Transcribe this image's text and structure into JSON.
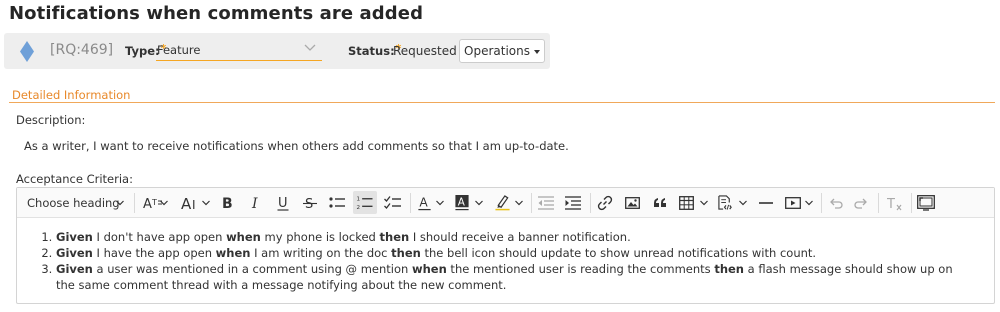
{
  "page": {
    "title": "Notifications when comments are added"
  },
  "header": {
    "req_id": "[RQ:469]",
    "type_label": "Type:",
    "required_star": "*",
    "type_value": "Feature",
    "status_label": "Status:",
    "status_value": "Requested",
    "operations_label": "Operations",
    "icon_color": "#6fa0d8"
  },
  "details": {
    "section_title": "Detailed Information",
    "description_label": "Description:",
    "description_text": "As a writer, I want to receive notifications when others add comments so that I am up-to-date.",
    "acceptance_label": "Acceptance Criteria:"
  },
  "editor": {
    "heading_dropdown": "Choose heading",
    "toolbar_icons": [
      "font-size-icon",
      "font-family-icon",
      "bold-icon",
      "italic-icon",
      "underline-icon",
      "strikethrough-icon",
      "bulleted-list-icon",
      "numbered-list-icon",
      "todo-list-icon",
      "font-color-icon",
      "background-color-icon",
      "highlight-icon",
      "outdent-icon",
      "indent-icon",
      "link-icon",
      "image-icon",
      "blockquote-icon",
      "table-icon",
      "source-editing-icon",
      "horizontal-line-icon",
      "media-embed-icon",
      "undo-icon",
      "redo-icon",
      "remove-format-icon",
      "fullscreen-icon"
    ],
    "criteria": [
      [
        {
          "t": "Given",
          "b": true
        },
        {
          "t": " I don't have app open ",
          "b": false
        },
        {
          "t": "when",
          "b": true
        },
        {
          "t": " my phone is locked ",
          "b": false
        },
        {
          "t": "then",
          "b": true
        },
        {
          "t": " I should receive a banner notification.",
          "b": false
        }
      ],
      [
        {
          "t": "Given",
          "b": true
        },
        {
          "t": " I have the app open ",
          "b": false
        },
        {
          "t": "when",
          "b": true
        },
        {
          "t": " I am writing on the doc ",
          "b": false
        },
        {
          "t": "then",
          "b": true
        },
        {
          "t": " the bell icon should update to show unread notifications with count.",
          "b": false
        }
      ],
      [
        {
          "t": "Given",
          "b": true
        },
        {
          "t": " a user was mentioned in a comment using @ mention ",
          "b": false
        },
        {
          "t": "when",
          "b": true
        },
        {
          "t": " the mentioned user is reading the comments ",
          "b": false
        },
        {
          "t": "then",
          "b": true
        },
        {
          "t": " a flash message should show up on the same comment thread with a message notifying about the new comment.",
          "b": false
        }
      ]
    ]
  }
}
